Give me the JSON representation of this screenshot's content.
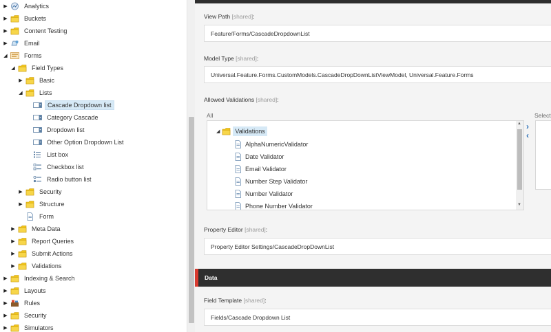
{
  "tree": {
    "items": [
      {
        "label": "Analytics",
        "icon": "analytics-icon",
        "arrow": "collapsed"
      },
      {
        "label": "Buckets",
        "icon": "folder-icon",
        "arrow": "collapsed"
      },
      {
        "label": "Content Testing",
        "icon": "folder-icon",
        "arrow": "collapsed"
      },
      {
        "label": "Email",
        "icon": "email-icon",
        "arrow": "collapsed"
      },
      {
        "label": "Forms",
        "icon": "forms-icon",
        "arrow": "expanded"
      },
      {
        "label": "Field Types",
        "icon": "folder-icon",
        "arrow": "expanded"
      },
      {
        "label": "Basic",
        "icon": "folder-icon",
        "arrow": "collapsed"
      },
      {
        "label": "Lists",
        "icon": "folder-icon",
        "arrow": "expanded"
      },
      {
        "label": "Cascade Dropdown list",
        "icon": "dropdown-field-icon",
        "arrow": "none",
        "selected": true
      },
      {
        "label": "Category Cascade",
        "icon": "dropdown-field-icon",
        "arrow": "none"
      },
      {
        "label": "Dropdown list",
        "icon": "dropdown-field-icon",
        "arrow": "none"
      },
      {
        "label": "Other Option Dropdown List",
        "icon": "dropdown-field-icon",
        "arrow": "none"
      },
      {
        "label": "List box",
        "icon": "listbox-icon",
        "arrow": "none"
      },
      {
        "label": "Checkbox list",
        "icon": "checkbox-list-icon",
        "arrow": "none"
      },
      {
        "label": "Radio button list",
        "icon": "radio-list-icon",
        "arrow": "none"
      },
      {
        "label": "Security",
        "icon": "folder-icon",
        "arrow": "collapsed"
      },
      {
        "label": "Structure",
        "icon": "folder-icon",
        "arrow": "collapsed"
      },
      {
        "label": "Form",
        "icon": "document-icon",
        "arrow": "none"
      },
      {
        "label": "Meta Data",
        "icon": "folder-icon",
        "arrow": "collapsed"
      },
      {
        "label": "Report Queries",
        "icon": "folder-icon",
        "arrow": "collapsed"
      },
      {
        "label": "Submit Actions",
        "icon": "folder-icon",
        "arrow": "collapsed"
      },
      {
        "label": "Validations",
        "icon": "folder-icon",
        "arrow": "collapsed"
      },
      {
        "label": "Indexing & Search",
        "icon": "folder-icon",
        "arrow": "collapsed"
      },
      {
        "label": "Layouts",
        "icon": "folder-icon",
        "arrow": "collapsed"
      },
      {
        "label": "Rules",
        "icon": "rules-icon",
        "arrow": "collapsed"
      },
      {
        "label": "Security",
        "icon": "folder-icon",
        "arrow": "collapsed"
      },
      {
        "label": "Simulators",
        "icon": "folder-icon",
        "arrow": "collapsed"
      }
    ]
  },
  "fields": {
    "view_path": {
      "label": "View Path",
      "shared": "[shared]",
      "suffix": ":",
      "value": "Feature/Forms/CascadeDropdownList"
    },
    "model_type": {
      "label": "Model Type",
      "shared": "[shared]",
      "suffix": ":",
      "value": "Universal.Feature.Forms.CustomModels.CascadeDropDownListViewModel, Universal.Feature.Forms"
    },
    "allowed_validations": {
      "label": "Allowed Validations",
      "shared": "[shared]",
      "suffix": ":",
      "all_label": "All",
      "selected_label": "Select"
    },
    "property_editor": {
      "label": "Property Editor",
      "shared": "[shared]",
      "suffix": ":",
      "value": "Property Editor Settings/CascadeDropDownList"
    },
    "field_template": {
      "label": "Field Template",
      "shared": "[shared]",
      "suffix": ":",
      "value": "Fields/Cascade Dropdown List"
    }
  },
  "validations": {
    "root": "Validations",
    "items": [
      "AlphaNumericValidator",
      "Date Validator",
      "Email Validator",
      "Number Step Validator",
      "Number Validator",
      "Phone Number Validator"
    ]
  },
  "move_buttons": {
    "add": "›",
    "remove": "‹"
  },
  "sections": {
    "data_title": "Data"
  },
  "colors": {
    "folder": "#f0c419",
    "accent_red": "#d83b30",
    "header_dark": "#2f2f2f",
    "selection": "#d6e9f6",
    "link_blue": "#2b6fb6"
  }
}
